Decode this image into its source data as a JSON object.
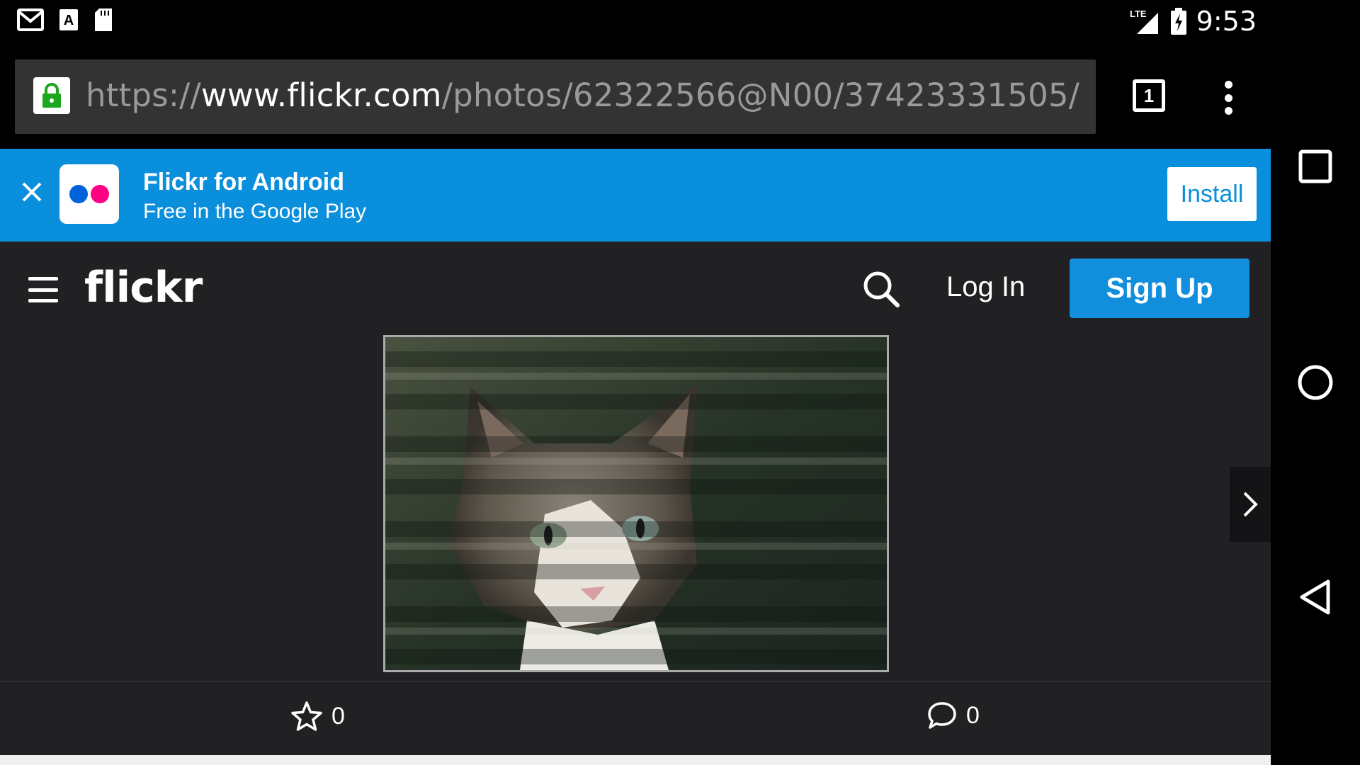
{
  "status_bar": {
    "time": "9:53",
    "network": "LTE",
    "icons": [
      "gmail-icon",
      "text-a-icon",
      "sd-card-icon",
      "signal-icon",
      "battery-charging-icon"
    ]
  },
  "browser": {
    "url_scheme": "https://",
    "url_host": "www.flickr.com",
    "url_path": "/photos/62322566@N00/37423331505/",
    "tab_count": "1"
  },
  "banner": {
    "title": "Flickr for Android",
    "subtitle": "Free in the Google Play",
    "install_label": "Install",
    "colors": {
      "background": "#0a8fdc",
      "blue_dot": "#0063dc",
      "pink_dot": "#ff0084"
    }
  },
  "nav": {
    "logo": "flickr",
    "login_label": "Log In",
    "signup_label": "Sign Up",
    "accent": "#128fdc"
  },
  "photo": {
    "subject": "tabby cat behind window blinds"
  },
  "actions": {
    "favorites_count": "0",
    "comments_count": "0"
  },
  "system_nav": [
    "overview-icon",
    "home-icon",
    "back-icon"
  ]
}
